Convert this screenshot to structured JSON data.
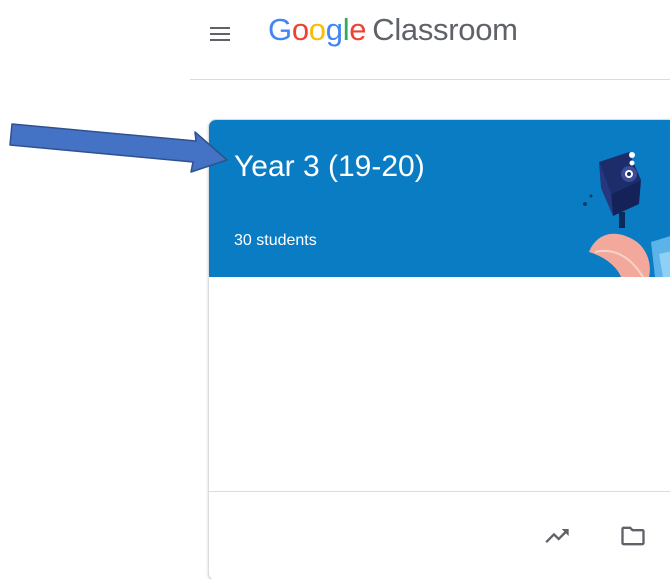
{
  "header": {
    "menu_icon": "hamburger-menu-icon",
    "logo": {
      "letters": [
        {
          "char": "G",
          "color": "#4285f4"
        },
        {
          "char": "o",
          "color": "#ea4335"
        },
        {
          "char": "o",
          "color": "#fbbc05"
        },
        {
          "char": "g",
          "color": "#4285f4"
        },
        {
          "char": "l",
          "color": "#34a853"
        },
        {
          "char": "e",
          "color": "#ea4335"
        }
      ],
      "product": "Classroom"
    }
  },
  "class_card": {
    "title": "Year 3 (19-20)",
    "subtitle": "30 students",
    "banner_color": "#0a7cc4",
    "footer_icons": [
      "trending-up-icon",
      "folder-icon"
    ]
  },
  "annotation": {
    "arrow_color": "#4472c4"
  }
}
